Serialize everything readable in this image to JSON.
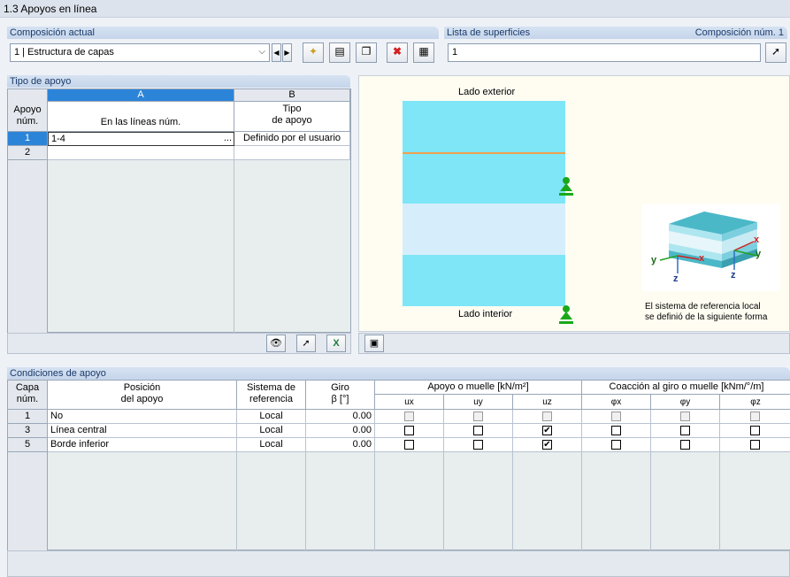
{
  "window": {
    "title": "1.3 Apoyos en línea"
  },
  "composition": {
    "header": "Composición actual",
    "selected": "1 | Estructura de capas"
  },
  "surfaces": {
    "header": "Lista de superficies",
    "comp_label": "Composición núm. 1",
    "value": "1"
  },
  "support_type": {
    "header": "Tipo de apoyo",
    "col_a": "A",
    "col_b": "B",
    "h_num_1": "Apoyo",
    "h_num_2": "núm.",
    "h_lines": "En las líneas núm.",
    "h_type_1": "Tipo",
    "h_type_2": "de apoyo",
    "rows": [
      {
        "num": "1",
        "lines": "1-4",
        "lines_btn": "...",
        "type": "Definido por el usuario"
      },
      {
        "num": "2",
        "lines": "",
        "type": ""
      }
    ]
  },
  "diagram": {
    "outer": "Lado exterior",
    "inner": "Lado interior",
    "note_1": "El sistema de referencia local",
    "note_2": "se definió de la siguiente forma",
    "axis_x": "x",
    "axis_y": "y",
    "axis_z": "z"
  },
  "conditions": {
    "header": "Condiciones de apoyo",
    "h_layer_1": "Capa",
    "h_layer_2": "núm.",
    "h_pos_1": "Posición",
    "h_pos_2": "del apoyo",
    "h_sys_1": "Sistema de",
    "h_sys_2": "referencia",
    "h_rot_1": "Giro",
    "h_rot_2": "β [°]",
    "h_spring": "Apoyo o muelle [kN/m²]",
    "h_rot_spring": "Coacción al giro o muelle [kNm/°/m]",
    "h_ux": "ux",
    "h_uy": "uy",
    "h_uz": "uz",
    "h_px": "φx",
    "h_py": "φy",
    "h_pz": "φz",
    "rows": [
      {
        "num": "1",
        "pos": "No",
        "sys": "Local",
        "rot": "0.00",
        "ux": false,
        "uy": false,
        "uz": false,
        "px": false,
        "py": false,
        "pz": false,
        "disabled": true
      },
      {
        "num": "3",
        "pos": "Línea central",
        "sys": "Local",
        "rot": "0.00",
        "ux": false,
        "uy": false,
        "uz": true,
        "px": false,
        "py": false,
        "pz": false,
        "disabled": false
      },
      {
        "num": "5",
        "pos": "Borde inferior",
        "sys": "Local",
        "rot": "0.00",
        "ux": false,
        "uy": false,
        "uz": true,
        "px": false,
        "py": false,
        "pz": false,
        "disabled": false
      }
    ]
  },
  "colors": {
    "accent": "#2b84d8",
    "layer_cyan": "#7ee6f7",
    "layer_light": "#d6eefb",
    "support_green": "#1aa81a",
    "line_orange": "#f0a050"
  }
}
